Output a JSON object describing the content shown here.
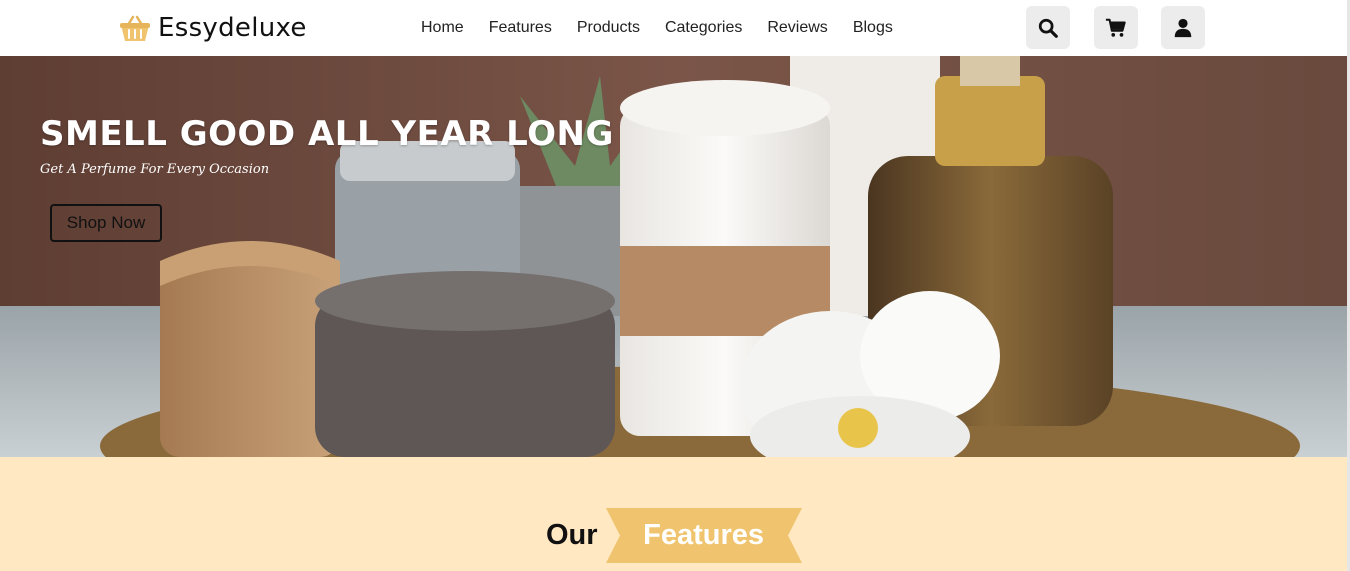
{
  "brand": {
    "name": "Essydeluxe",
    "icon": "basket-icon",
    "accent": "#f0c46e"
  },
  "nav": {
    "items": [
      {
        "label": "Home"
      },
      {
        "label": "Features"
      },
      {
        "label": "Products"
      },
      {
        "label": "Categories"
      },
      {
        "label": "Reviews"
      },
      {
        "label": "Blogs"
      }
    ]
  },
  "header_icons": [
    "search-icon",
    "cart-icon",
    "user-icon"
  ],
  "hero": {
    "title": "SMELL GOOD ALL YEAR LONG",
    "subtitle": "Get A Perfume For Every Occasion",
    "cta_label": "Shop Now"
  },
  "features": {
    "heading_prefix": "Our",
    "heading_highlight": "Features",
    "background": "#ffe8c2"
  }
}
